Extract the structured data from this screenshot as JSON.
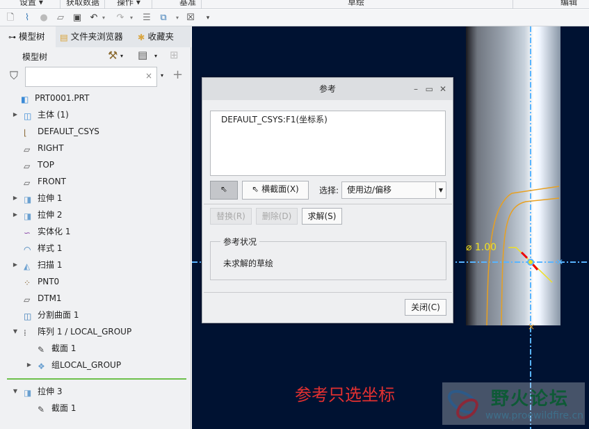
{
  "menu": [
    "设置 ▾",
    "获取数据",
    "操作 ▾",
    "基准",
    "草绘",
    "编辑"
  ],
  "tabs": {
    "model_tree": "模型树",
    "folder_browser": "文件夹浏览器",
    "favorites": "收藏夹"
  },
  "tree_header": "模型树",
  "filter": {
    "value": "",
    "clear": "×"
  },
  "tree": [
    {
      "label": "PRT0001.PRT",
      "level": 0,
      "arrow": "",
      "icon": "part-icon",
      "color": "#3a8ad6"
    },
    {
      "label": "主体 (1)",
      "level": 1,
      "arrow": "▶",
      "icon": "body-icon",
      "color": "#3a8ad6"
    },
    {
      "label": "DEFAULT_CSYS",
      "level": 1,
      "arrow": "",
      "icon": "csys-icon",
      "color": "#8a6a3a"
    },
    {
      "label": "RIGHT",
      "level": 1,
      "arrow": "",
      "icon": "plane-icon",
      "color": "#555"
    },
    {
      "label": "TOP",
      "level": 1,
      "arrow": "",
      "icon": "plane-icon",
      "color": "#555"
    },
    {
      "label": "FRONT",
      "level": 1,
      "arrow": "",
      "icon": "plane-icon",
      "color": "#555"
    },
    {
      "label": "拉伸 1",
      "level": 1,
      "arrow": "▶",
      "icon": "extrude-icon",
      "color": "#6aa0d0"
    },
    {
      "label": "拉伸 2",
      "level": 1,
      "arrow": "▶",
      "icon": "extrude-icon",
      "color": "#6aa0d0"
    },
    {
      "label": "实体化 1",
      "level": 1,
      "arrow": "",
      "icon": "solidify-icon",
      "color": "#8a4aa8"
    },
    {
      "label": "样式 1",
      "level": 1,
      "arrow": "",
      "icon": "style-icon",
      "color": "#3a7ab6"
    },
    {
      "label": "扫描 1",
      "level": 1,
      "arrow": "▶",
      "icon": "sweep-icon",
      "color": "#6aa0d0"
    },
    {
      "label": "PNT0",
      "level": 1,
      "arrow": "",
      "icon": "point-icon",
      "color": "#8a6a3a"
    },
    {
      "label": "DTM1",
      "level": 1,
      "arrow": "",
      "icon": "plane-icon",
      "color": "#555"
    },
    {
      "label": "分割曲面 1",
      "level": 1,
      "arrow": "",
      "icon": "split-surface-icon",
      "color": "#3a7ab6"
    },
    {
      "label": "阵列 1 / LOCAL_GROUP",
      "level": 1,
      "arrow": "▼",
      "icon": "pattern-icon",
      "color": "#555"
    },
    {
      "label": "截面 1",
      "level": 2,
      "arrow": "",
      "icon": "sketch-icon",
      "color": "#444"
    },
    {
      "label": "组LOCAL_GROUP",
      "level": 2,
      "arrow": "▶",
      "icon": "group-icon",
      "color": "#6aa0d0"
    }
  ],
  "tree_active": [
    {
      "label": "拉伸 3",
      "level": 1,
      "arrow": "▼",
      "icon": "extrude-icon",
      "color": "#6aa0d0"
    },
    {
      "label": "截面 1",
      "level": 2,
      "arrow": "",
      "icon": "sketch-icon",
      "color": "#444"
    }
  ],
  "dialog": {
    "title": "参考",
    "references": [
      "DEFAULT_CSYS:F1(坐标系)"
    ],
    "cross_section": "横截面(X)",
    "select_label": "选择:",
    "select_value": "使用边/偏移",
    "replace": "替换(R)",
    "delete": "删除(D)",
    "solve": "求解(S)",
    "status_group": "参考状况",
    "status_text": "未求解的草绘",
    "close": "关闭(C)"
  },
  "dimension": "⌀ 1.00",
  "annotation": "参考只选坐标",
  "watermark": {
    "title": "野火论坛",
    "url": "www.proewildfire.cn"
  }
}
